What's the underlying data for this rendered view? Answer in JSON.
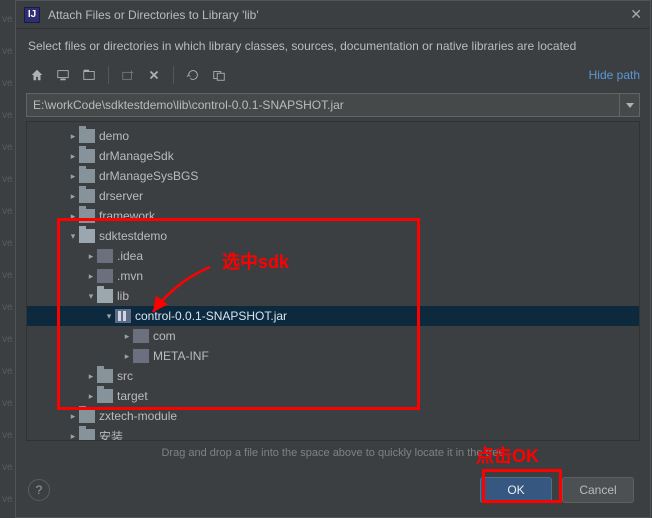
{
  "dialog": {
    "title": "Attach Files or Directories to Library 'lib'",
    "instruction": "Select files or directories in which library classes, sources, documentation or native libraries are located",
    "hide_path": "Hide path",
    "path_value": "E:\\workCode\\sdktestdemo\\lib\\control-0.0.1-SNAPSHOT.jar",
    "hint": "Drag and drop a file into the space above to quickly locate it in the tree",
    "ok_label": "OK",
    "cancel_label": "Cancel"
  },
  "toolbar": {
    "home": "home-icon",
    "desktop": "desktop-icon",
    "project": "project-icon",
    "newfolder": "new-folder-icon",
    "delete": "delete-icon",
    "refresh": "refresh-icon",
    "toggle": "show-hidden-icon"
  },
  "tree": [
    {
      "depth": 2,
      "arrow": "right",
      "icon": "folder",
      "label": "demo"
    },
    {
      "depth": 2,
      "arrow": "right",
      "icon": "folder",
      "label": "drManageSdk"
    },
    {
      "depth": 2,
      "arrow": "right",
      "icon": "folder",
      "label": "drManageSysBGS"
    },
    {
      "depth": 2,
      "arrow": "right",
      "icon": "folder",
      "label": "drserver"
    },
    {
      "depth": 2,
      "arrow": "right",
      "icon": "folder",
      "label": "framework"
    },
    {
      "depth": 2,
      "arrow": "down",
      "icon": "folder-open",
      "label": "sdktestdemo"
    },
    {
      "depth": 3,
      "arrow": "right",
      "icon": "idea",
      "label": ".idea"
    },
    {
      "depth": 3,
      "arrow": "right",
      "icon": "idea",
      "label": ".mvn"
    },
    {
      "depth": 3,
      "arrow": "down",
      "icon": "folder-open",
      "label": "lib"
    },
    {
      "depth": 4,
      "arrow": "down",
      "icon": "jar",
      "label": "control-0.0.1-SNAPSHOT.jar",
      "selected": true
    },
    {
      "depth": 5,
      "arrow": "right",
      "icon": "idea",
      "label": "com"
    },
    {
      "depth": 5,
      "arrow": "right",
      "icon": "idea",
      "label": "META-INF"
    },
    {
      "depth": 3,
      "arrow": "right",
      "icon": "folder",
      "label": "src"
    },
    {
      "depth": 3,
      "arrow": "right",
      "icon": "folder",
      "label": "target"
    },
    {
      "depth": 2,
      "arrow": "right",
      "icon": "folder",
      "label": "zxtech-module"
    },
    {
      "depth": 2,
      "arrow": "right",
      "icon": "folder",
      "label": "安装"
    }
  ],
  "annotations": {
    "select_sdk": "选中sdk",
    "click_ok": "点击OK"
  },
  "left_markers": [
    "ve",
    "ve",
    "ve",
    "ve",
    "ve",
    "ve",
    "ve",
    "ve",
    "ve",
    "ve",
    "ve",
    "ve",
    "ve",
    "ve",
    "ve",
    "ve"
  ]
}
